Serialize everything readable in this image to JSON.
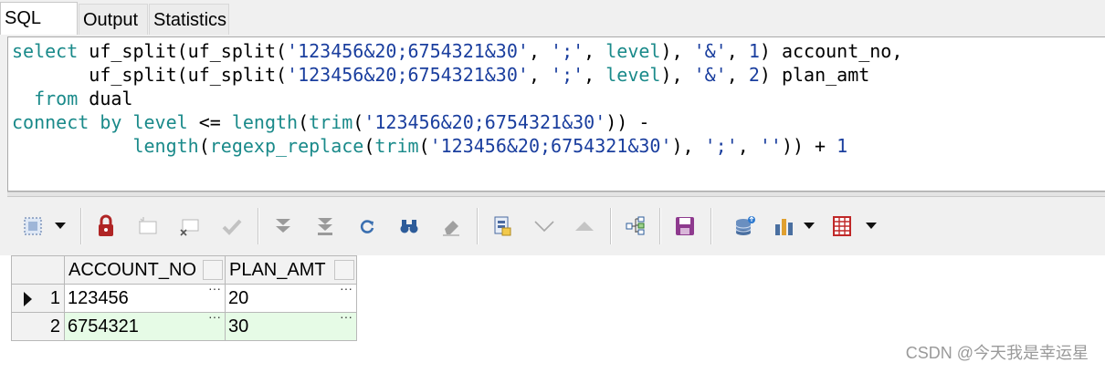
{
  "tabs": [
    {
      "label": "SQL",
      "active": true
    },
    {
      "label": "Output",
      "active": false
    },
    {
      "label": "Statistics",
      "active": false
    }
  ],
  "editor": {
    "line1": {
      "kw1": "select",
      "t1": " uf_split(uf_split(",
      "s1": "'123456&20;6754321&30'",
      "t2": ", ",
      "s2": "';'",
      "t3": ", ",
      "kw2": "level",
      "t4": "), ",
      "s3": "'&'",
      "t5": ", ",
      "n1": "1",
      "t6": ") account_no,"
    },
    "line2": {
      "t1": "       uf_split(uf_split(",
      "s1": "'123456&20;6754321&30'",
      "t2": ", ",
      "s2": "';'",
      "t3": ", ",
      "kw2": "level",
      "t4": "), ",
      "s3": "'&'",
      "t5": ", ",
      "n1": "2",
      "t6": ") plan_amt"
    },
    "line3": {
      "pad": "  ",
      "kw1": "from",
      "t1": " dual"
    },
    "line4": {
      "kw1": "connect by level",
      "t1": " <= ",
      "kw2": "length",
      "t2": "(",
      "kw3": "trim",
      "t3": "(",
      "s1": "'123456&20;6754321&30'",
      "t4": ")) -"
    },
    "line5": {
      "pad": "           ",
      "kw1": "length",
      "t1": "(",
      "kw2": "regexp_replace",
      "t2": "(",
      "kw3": "trim",
      "t3": "(",
      "s1": "'123456&20;6754321&30'",
      "t4": "), ",
      "s2": "';'",
      "t5": ", ",
      "s3": "''",
      "t6": ")) + ",
      "n1": "1"
    }
  },
  "grid": {
    "columns": [
      "ACCOUNT_NO",
      "PLAN_AMT"
    ],
    "rows": [
      {
        "num": "1",
        "account_no": "123456",
        "plan_amt": "20"
      },
      {
        "num": "2",
        "account_no": "6754321",
        "plan_amt": "30"
      }
    ],
    "cell_button": "···"
  },
  "watermark": "CSDN @今天我是幸运星",
  "colors": {
    "keyword": "#1a8a8a",
    "string": "#1a3e9e",
    "alt_row": "#e6fbe6",
    "lock": "#b02525"
  }
}
